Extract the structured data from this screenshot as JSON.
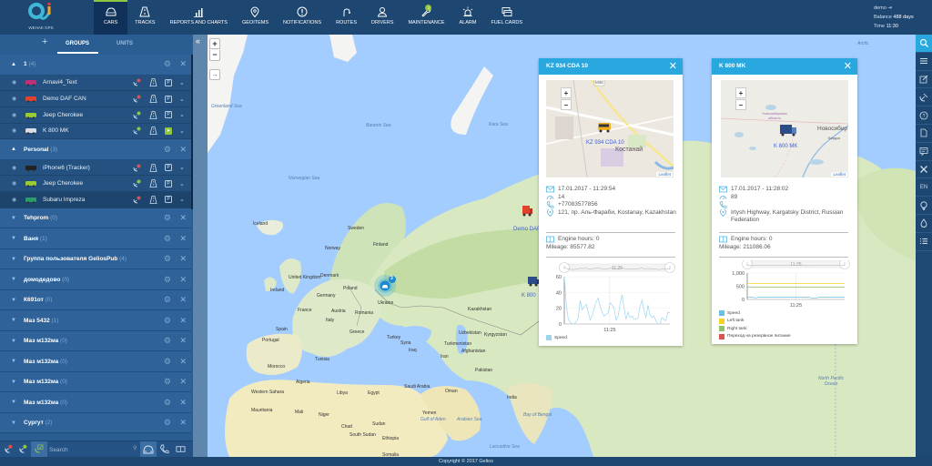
{
  "app": {
    "brand_text": "WEHAK GPS",
    "copyright": "Copyright © 2017 Gelios"
  },
  "nav": [
    {
      "id": "cars",
      "label": "CARS",
      "icon": "car-icon",
      "active": true
    },
    {
      "id": "tracks",
      "label": "TRACKS",
      "icon": "road-icon"
    },
    {
      "id": "reports",
      "label": "REPORTS AND CHARTS",
      "icon": "bar-chart-icon"
    },
    {
      "id": "geoitems",
      "label": "GEOITEMS",
      "icon": "map-pin-icon"
    },
    {
      "id": "notifications",
      "label": "NOTIFICATIONS",
      "icon": "alert-circle-icon"
    },
    {
      "id": "routes",
      "label": "ROUTES",
      "icon": "route-icon"
    },
    {
      "id": "drivers",
      "label": "DRIVERS",
      "icon": "user-icon"
    },
    {
      "id": "maintenance",
      "label": "MAINTENANCE",
      "icon": "wrench-icon",
      "badge": "1"
    },
    {
      "id": "alarm",
      "label": "ALARM",
      "icon": "siren-icon"
    },
    {
      "id": "fuel",
      "label": "FUEL CARDS",
      "icon": "cards-icon"
    }
  ],
  "account": {
    "user": "demo",
    "balance_label": "Balance",
    "balance_value": "488 days",
    "time_label": "Time",
    "time_value": "11:30"
  },
  "sidebar": {
    "add_label": "+",
    "tabs": [
      {
        "label": "GROUPS",
        "active": true
      },
      {
        "label": "UNITS"
      }
    ],
    "groups": [
      {
        "name": "1",
        "count": "(4)",
        "expanded": true,
        "units": [
          {
            "name": "Arnavi4_Text",
            "sat": "red",
            "park": "P"
          },
          {
            "name": "Demo DAF CAN",
            "sat": "red",
            "park": "P"
          },
          {
            "name": "Jeep Cherokee",
            "sat": "green",
            "park": "P"
          },
          {
            "name": "K 800 MK",
            "sat": "green",
            "park": "go"
          }
        ]
      },
      {
        "name": "Personal",
        "count": "(3)",
        "expanded": true,
        "units": [
          {
            "name": "iPhone6 (Tracker)",
            "sat": "red",
            "park": "P"
          },
          {
            "name": "Jeep Cherokee",
            "sat": "green",
            "park": "P"
          },
          {
            "name": "Subaru Impreza",
            "sat": "red",
            "park": "P"
          }
        ]
      },
      {
        "name": "Tehprom",
        "count": "(0)"
      },
      {
        "name": "Ваня",
        "count": "(1)"
      },
      {
        "name": "Группа пользователя GeliosPub",
        "count": "(4)"
      },
      {
        "name": "домодедово",
        "count": "(0)"
      },
      {
        "name": "К691от",
        "count": "(0)"
      },
      {
        "name": "Маз 5432",
        "count": "(1)"
      },
      {
        "name": "Маз м132ма",
        "count": "(0)"
      },
      {
        "name": "Маз м132ма",
        "count": "(0)"
      },
      {
        "name": "Маз м132ма",
        "count": "(0)"
      },
      {
        "name": "Маз м132ма",
        "count": "(0)"
      },
      {
        "name": "Сургут",
        "count": "(2)"
      }
    ],
    "search_placeholder": "Search"
  },
  "map": {
    "labels": [
      {
        "t": "Greenland Sea",
        "sea": true
      },
      {
        "t": "Barents Sea",
        "sea": true
      },
      {
        "t": "Kara Sea",
        "sea": true
      },
      {
        "t": "Norwegian Sea",
        "sea": true
      },
      {
        "t": "Iceland"
      },
      {
        "t": "Sweden"
      },
      {
        "t": "Finland"
      },
      {
        "t": "Norway"
      },
      {
        "t": "Ireland"
      },
      {
        "t": "United Kingdom"
      },
      {
        "t": "Denmark"
      },
      {
        "t": "Poland"
      },
      {
        "t": "Germany"
      },
      {
        "t": "Ukraine"
      },
      {
        "t": "France"
      },
      {
        "t": "Austria"
      },
      {
        "t": "Romania"
      },
      {
        "t": "Italy"
      },
      {
        "t": "Spain"
      },
      {
        "t": "Portugal"
      },
      {
        "t": "Greece"
      },
      {
        "t": "Turkey"
      },
      {
        "t": "Kazakhstan"
      },
      {
        "t": "Uzbekistan"
      },
      {
        "t": "Turkmenistan"
      },
      {
        "t": "Kyrgyzstan"
      },
      {
        "t": "Syria"
      },
      {
        "t": "Iraq"
      },
      {
        "t": "Iran"
      },
      {
        "t": "Afghanistan"
      },
      {
        "t": "Pakistan"
      },
      {
        "t": "Tunisia"
      },
      {
        "t": "Morocco"
      },
      {
        "t": "Algeria"
      },
      {
        "t": "Libya"
      },
      {
        "t": "Egypt"
      },
      {
        "t": "Saudi Arabia"
      },
      {
        "t": "Oman"
      },
      {
        "t": "Yemen"
      },
      {
        "t": "India"
      },
      {
        "t": "Western Sahara"
      },
      {
        "t": "Mauritania"
      },
      {
        "t": "Mali"
      },
      {
        "t": "Niger"
      },
      {
        "t": "Chad"
      },
      {
        "t": "Sudan"
      },
      {
        "t": "South Sudan"
      },
      {
        "t": "Ethiopia"
      },
      {
        "t": "Somalia"
      },
      {
        "t": "Gulf of Aden",
        "sea": true
      },
      {
        "t": "Arabian Sea",
        "sea": true
      },
      {
        "t": "Laccadive Sea",
        "sea": true
      },
      {
        "t": "Japan"
      },
      {
        "t": "North Pacific Ocean",
        "sea": true
      },
      {
        "t": "Arctic",
        "sea": true
      },
      {
        "t": "Bay of Bengal",
        "sea": true
      }
    ],
    "cluster_count": "3",
    "unit_labels": [
      "Demo DAF",
      "K 800"
    ],
    "zoom_in": "+",
    "zoom_out": "−",
    "collapse": "«",
    "route": "→"
  },
  "right_toolbar": [
    {
      "icon": "search-icon",
      "active": true
    },
    {
      "icon": "menu-icon"
    },
    {
      "icon": "edit-icon"
    },
    {
      "icon": "satellite-icon"
    },
    {
      "icon": "help-icon"
    },
    {
      "icon": "document-icon"
    },
    {
      "icon": "message-icon"
    },
    {
      "icon": "tools-icon"
    },
    {
      "icon": "language-label",
      "text": "EN"
    },
    {
      "icon": "bulb-icon"
    },
    {
      "icon": "drop-icon"
    },
    {
      "icon": "list-icon"
    }
  ],
  "popups": [
    {
      "title": "KZ 934 CDA 10",
      "mini_map_label": "KZ 934 CDA 10",
      "mini_map_city": "Костанай",
      "mini_road": "M36",
      "leaflet": "Leaflet",
      "datetime": "17.01.2017 - 11:29:54",
      "speed": "14",
      "phone": "+77083577856",
      "address": "121, пр. Аль-Фараби, Kostanay, Kazakhstan",
      "engine_hours": "Engine hours: 0",
      "mileage": "Mileage: 85577.82",
      "chart_data": {
        "type": "line",
        "y_ticks": [
          "0",
          "20",
          "40",
          "60"
        ],
        "ylim": [
          0,
          60
        ],
        "x_tick": "11:25",
        "navigator_label": "11:25",
        "series": [
          {
            "name": "Speed",
            "color": "#9fd4ef",
            "values": [
              60,
              25,
              6,
              2,
              0,
              0,
              3,
              8,
              30,
              18,
              22,
              25,
              15,
              5,
              10,
              20,
              28,
              33,
              22,
              15,
              10,
              12,
              14,
              27,
              24,
              20,
              5,
              10,
              25,
              37,
              20,
              6,
              15,
              8,
              10,
              6,
              6,
              8,
              22,
              30,
              18,
              8,
              24,
              12,
              8,
              10,
              4,
              0,
              0,
              8,
              6,
              4,
              15,
              14
            ]
          }
        ],
        "legend": [
          "Speed"
        ]
      }
    },
    {
      "title": "K 800 MK",
      "mini_map_label": "K 800 MK",
      "mini_map_city": "Новосибир",
      "mini_map_region": "Новосибирская область",
      "mini_map_town": "Бердск",
      "leaflet": "Leaflet",
      "datetime": "17.01.2017 - 11:28:02",
      "speed": "89",
      "phone": "",
      "address": "Irtysh Highway, Kargatsky District, Russian Federation",
      "engine_hours": "Engine hours: 0",
      "mileage": "Mileage: 211086.06",
      "chart_data": {
        "type": "line",
        "y_ticks": [
          "0",
          "500",
          "1,000"
        ],
        "ylim": [
          0,
          1000
        ],
        "x_tick": "11:25",
        "navigator_label": "11:25",
        "series": [
          {
            "name": "Speed",
            "color": "#6cc0e5",
            "values": [
              89,
              89,
              60,
              89,
              89,
              89,
              89,
              89,
              89,
              89,
              89,
              89,
              89,
              89,
              89,
              89,
              60,
              60,
              89,
              89,
              89,
              89,
              89,
              89,
              89
            ]
          },
          {
            "name": "Left tank",
            "color": "#f5d21e",
            "values": [
              600,
              600,
              600,
              600,
              600,
              600,
              600,
              600,
              600,
              600,
              600,
              600,
              600,
              600,
              600,
              600,
              600,
              600,
              600,
              600,
              600,
              600,
              600,
              600,
              600
            ]
          },
          {
            "name": "Right tank",
            "color": "#8fc26a",
            "values": [
              470,
              470,
              470,
              470,
              470,
              470,
              470,
              470,
              470,
              470,
              470,
              470,
              470,
              470,
              470,
              470,
              470,
              470,
              470,
              470,
              470,
              470,
              470,
              470,
              470
            ]
          },
          {
            "name": "Переход на резервное питание",
            "color": "#d9534f",
            "values": []
          }
        ],
        "legend": [
          "Speed",
          "Left tank",
          "Right tank",
          "Переход на резервное питание"
        ]
      }
    }
  ]
}
